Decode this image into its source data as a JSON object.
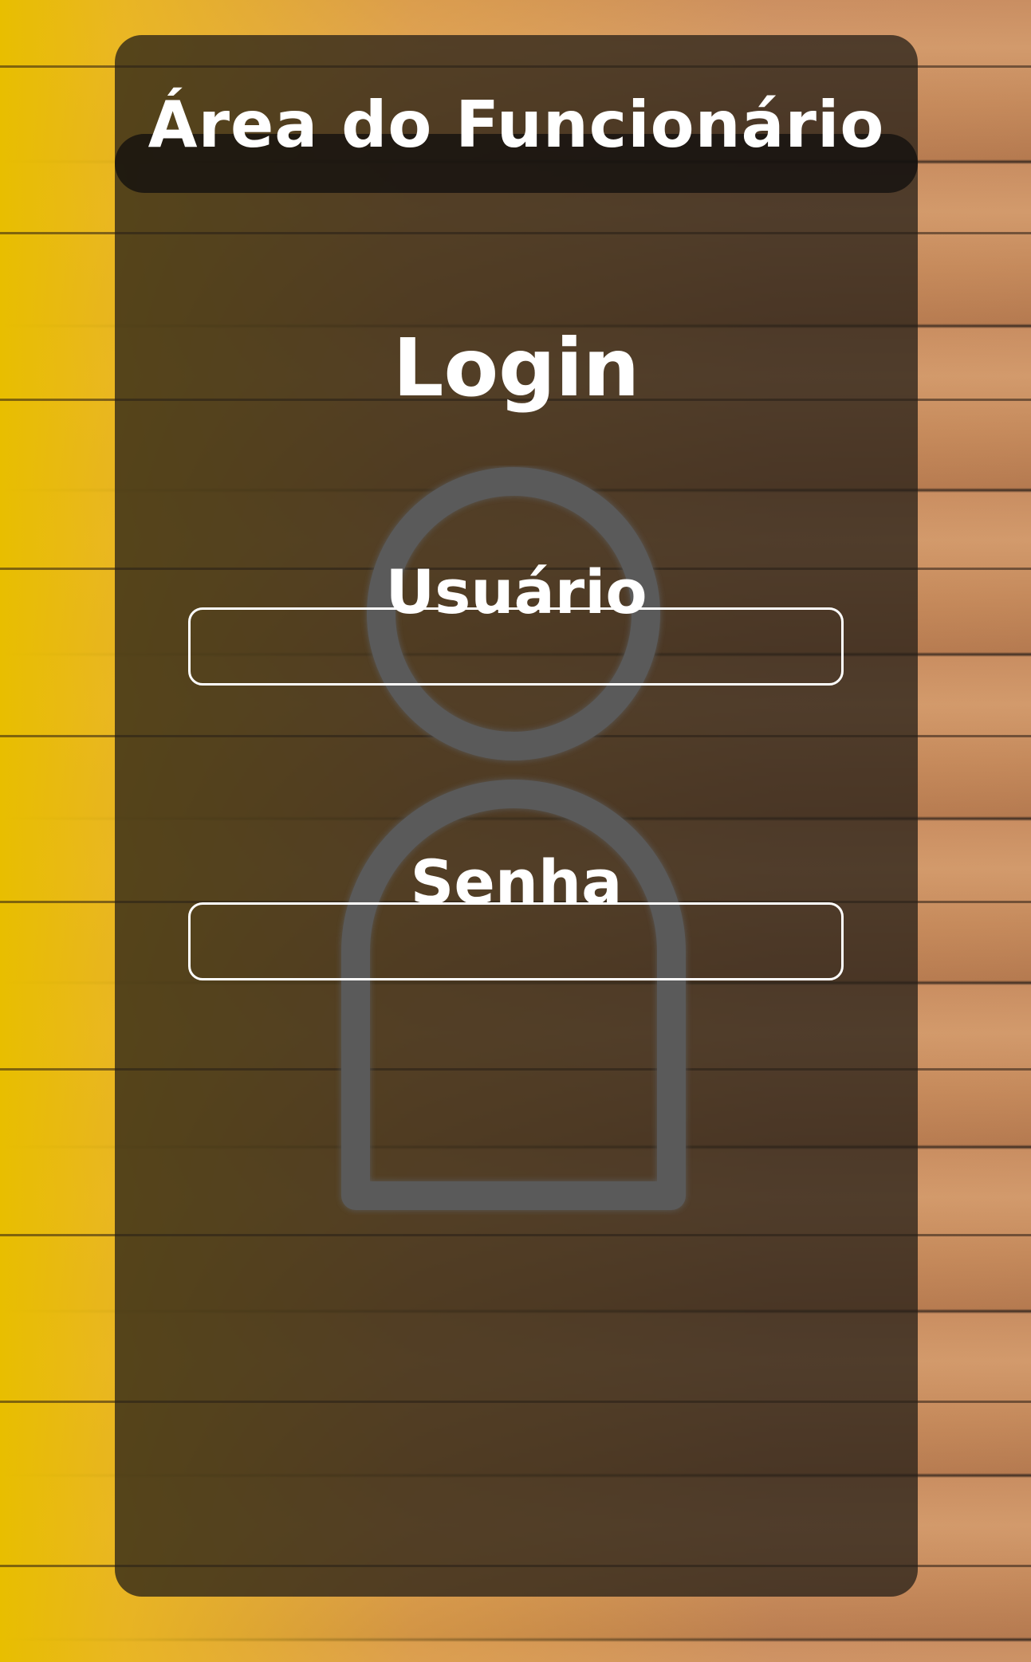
{
  "page": {
    "header_title": "Área do Funcionário",
    "login_title": "Login"
  },
  "form": {
    "username": {
      "label": "Usuário",
      "value": ""
    },
    "password": {
      "label": "Senha",
      "value": ""
    }
  },
  "icons": {
    "background_glyph": "user-silhouette-icon"
  },
  "colors": {
    "accent_yellow": "#E8BE00",
    "panel": "#262018",
    "text": "#FFFFFF",
    "glyph": "#5A5A5A"
  }
}
